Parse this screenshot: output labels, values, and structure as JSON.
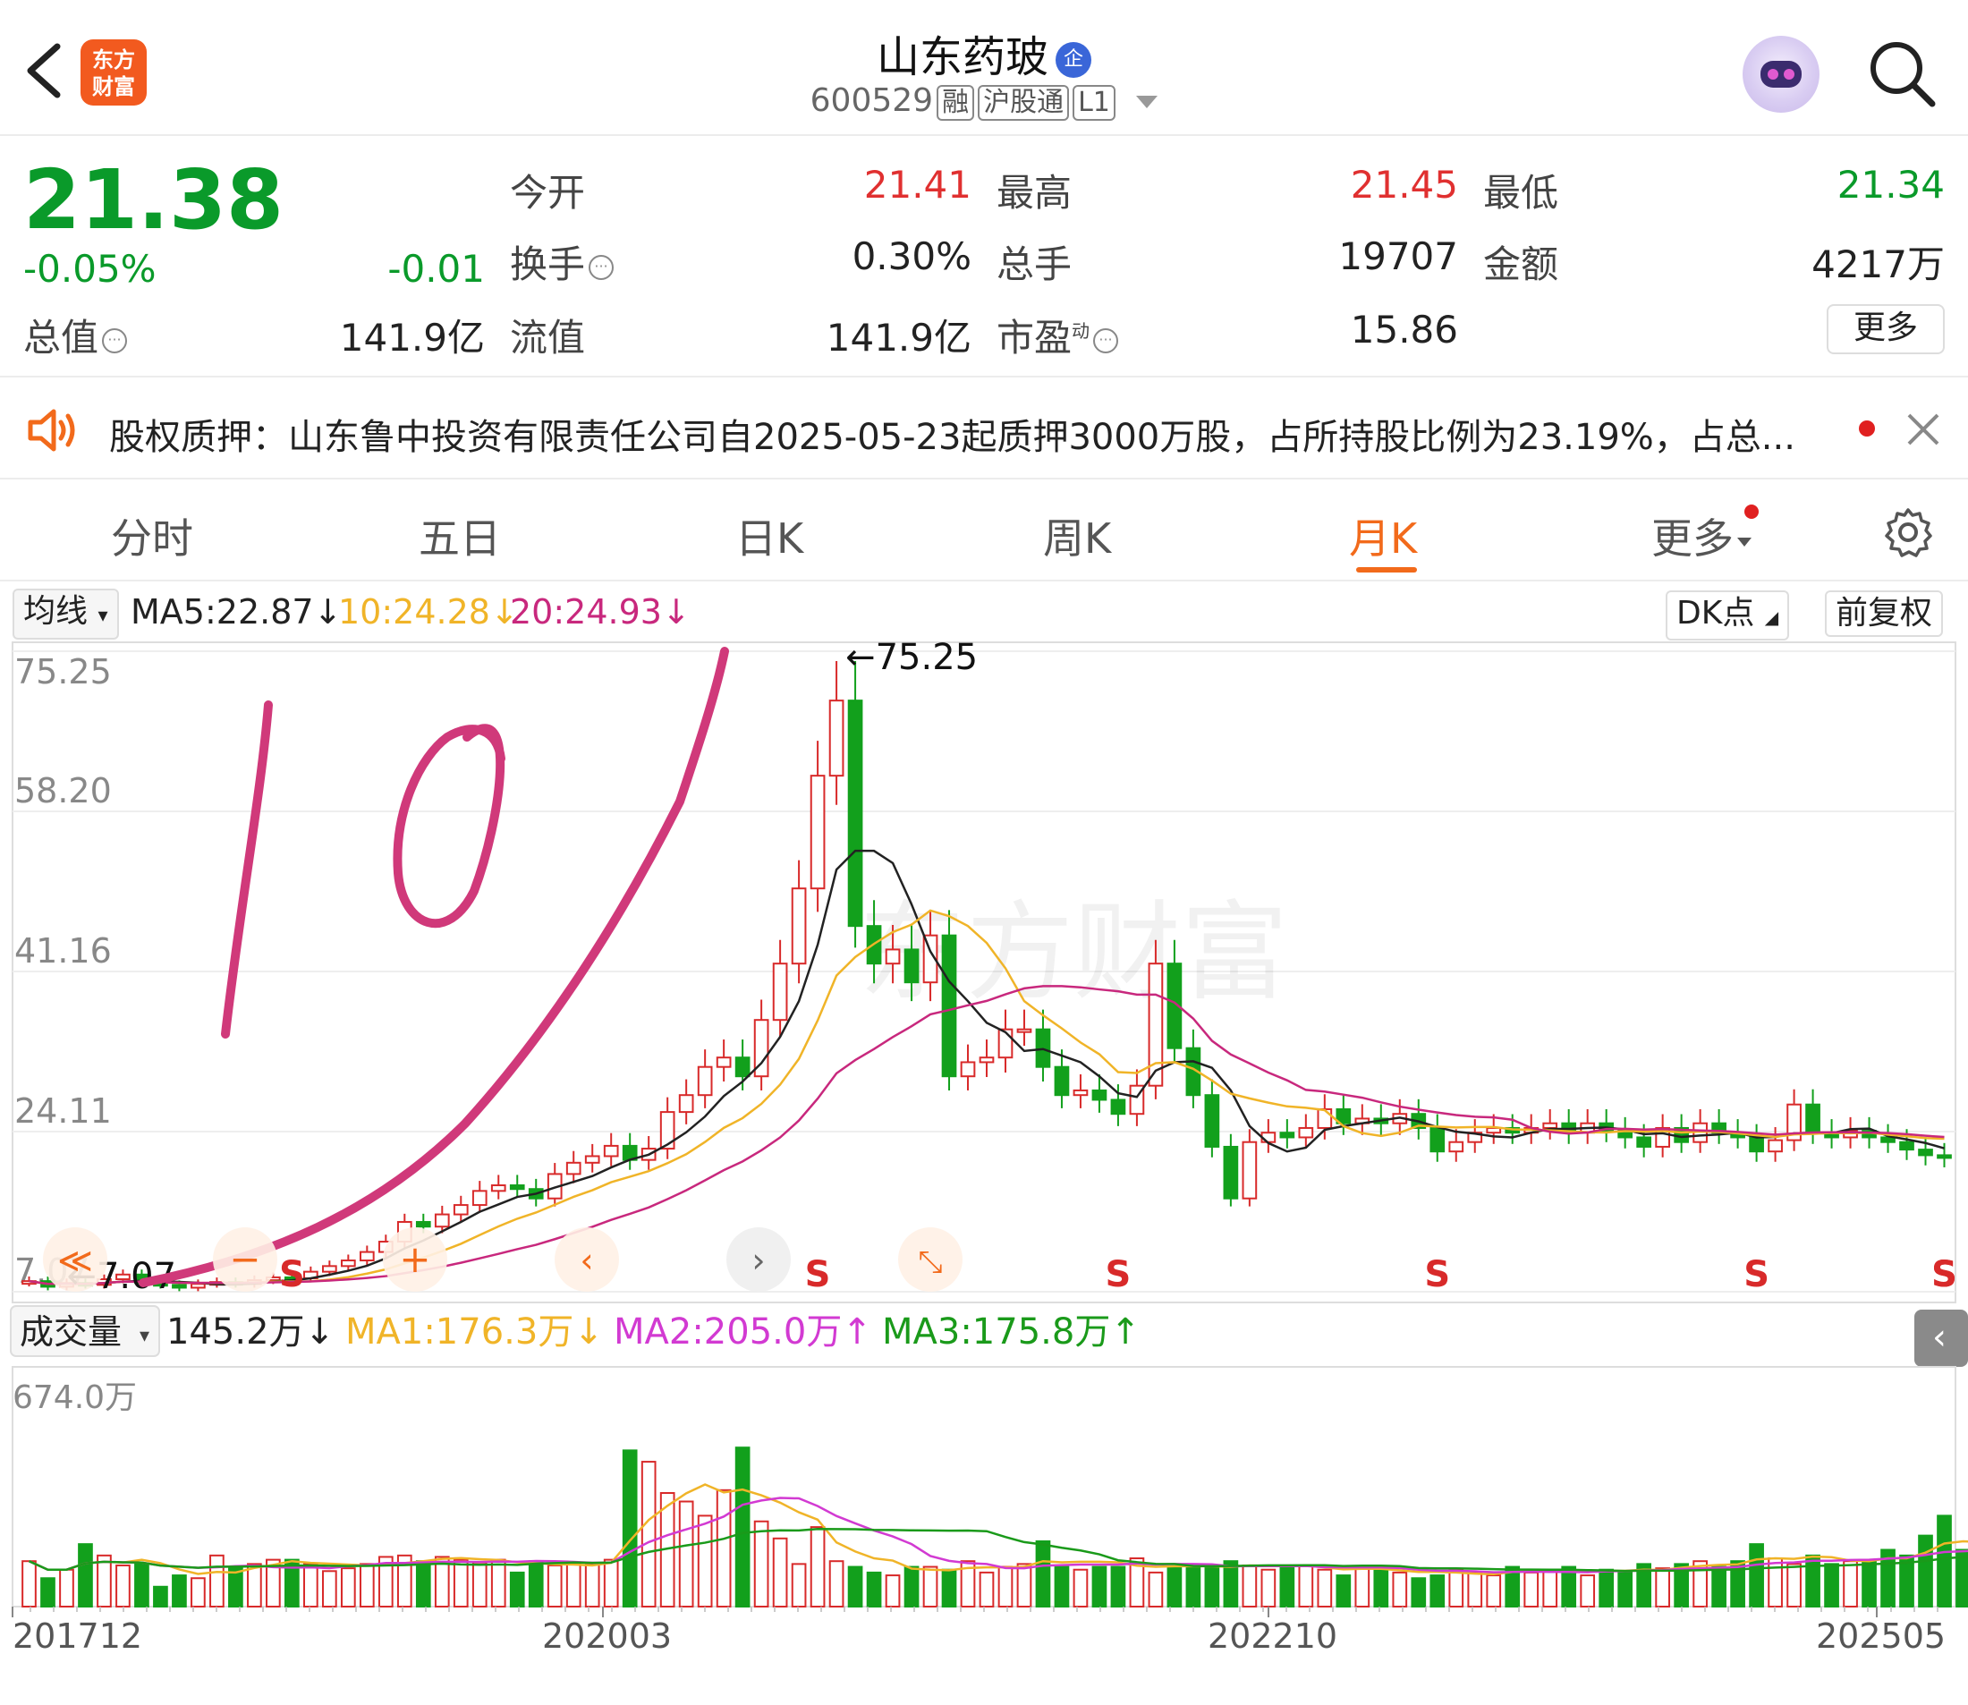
{
  "header": {
    "back_icon": "back-arrow-icon",
    "logo_line1": "东方",
    "logo_line2": "财富",
    "title": "山东药玻",
    "corp_badge": "企",
    "code": "600529",
    "tags": [
      "融",
      "沪股通",
      "L1"
    ]
  },
  "quote": {
    "price": "21.38",
    "change_pct": "-0.05%",
    "change": "-0.01",
    "cells": [
      {
        "label": "今开",
        "value": "21.41",
        "color": "red"
      },
      {
        "label": "最高",
        "value": "21.45",
        "color": "red"
      },
      {
        "label": "最低",
        "value": "21.34",
        "color": "green"
      },
      {
        "label": "换手",
        "value": "0.30%",
        "color": "dark",
        "info": true
      },
      {
        "label": "总手",
        "value": "19707",
        "color": "dark"
      },
      {
        "label": "金额",
        "value": "4217万",
        "color": "dark"
      },
      {
        "label": "流值",
        "value": "141.9亿",
        "color": "dark"
      },
      {
        "label": "市盈",
        "sup": "动",
        "value": "15.86",
        "color": "dark",
        "info": true
      }
    ],
    "total_label": "总值",
    "total_value": "141.9亿",
    "more": "更多"
  },
  "notice": {
    "text": "股权质押：山东鲁中投资有限责任公司自2025-05-23起质押3000万股，占所持股比例为23.19%，占总..."
  },
  "tabs": [
    "分时",
    "五日",
    "日K",
    "周K",
    "月K",
    "更多"
  ],
  "active_tab": "月K",
  "ma": {
    "selector": "均线",
    "ma5": "MA5:22.87↓",
    "ma10": "10:24.28↓",
    "ma20": "20:24.93↓",
    "dk": "DK点",
    "fq": "前复权",
    "colors": {
      "ma5": "#222222",
      "ma10": "#f0b428",
      "ma20": "#c8287d"
    }
  },
  "volume": {
    "selector": "成交量",
    "val": "145.2万↓",
    "ma1": "MA1:176.3万↓",
    "ma2": "MA2:205.0万↑",
    "ma3": "MA3:175.8万↑",
    "colors": {
      "ma1": "#f0b428",
      "ma2": "#d23ad2",
      "ma3": "#1a9a1a"
    }
  },
  "chart_data": {
    "type": "candlestick",
    "y_ticks": [
      "75.25",
      "58.20",
      "41.16",
      "24.11",
      "7.07"
    ],
    "ylim": [
      7.07,
      75.25
    ],
    "high_label": "←75.25",
    "low_label": "←7.07",
    "vol_tick": "674.0万",
    "vol_max": 674,
    "x_ticks": [
      "201712",
      "202003",
      "202210",
      "202505"
    ],
    "signals": [
      "S",
      "S",
      "S",
      "S",
      "S",
      "S",
      "S"
    ],
    "colors": {
      "up": "#d82a2a",
      "down": "#12a01c",
      "grid": "#eeeeee"
    },
    "closes": [
      8.2,
      7.6,
      8.0,
      7.8,
      8.4,
      8.9,
      8.0,
      7.8,
      7.5,
      7.9,
      8.1,
      7.9,
      8.3,
      8.6,
      8.5,
      9.2,
      9.8,
      10.4,
      11.3,
      12.4,
      14.5,
      14.0,
      15.3,
      16.3,
      17.8,
      18.4,
      18.0,
      17.0,
      19.6,
      20.8,
      21.5,
      22.6,
      21.1,
      22.3,
      26.2,
      28.0,
      31.0,
      32.0,
      30.0,
      36.0,
      42.0,
      50.0,
      62.0,
      70.0,
      46.0,
      42.0,
      43.5,
      40.0,
      45.0,
      30.0,
      31.5,
      32.0,
      35.0,
      35.0,
      31.0,
      28.0,
      28.5,
      27.5,
      26.0,
      29.0,
      42.0,
      33.0,
      28.0,
      22.5,
      17.0,
      23.0,
      24.0,
      23.5,
      24.5,
      26.5,
      25.0,
      25.5,
      25.0,
      26.0,
      24.5,
      22.0,
      23.0,
      24.0,
      24.5,
      24.0,
      24.5,
      25.0,
      24.0,
      25.0,
      24.2,
      23.5,
      22.5,
      24.5,
      23.0,
      25.0,
      24.0,
      23.5,
      22.0,
      23.2,
      27.0,
      24.0,
      23.5,
      24.2,
      23.5,
      23.0,
      22.2,
      21.6,
      21.38
    ],
    "volumes": [
      160,
      100,
      130,
      220,
      180,
      145,
      150,
      70,
      110,
      100,
      180,
      140,
      150,
      165,
      165,
      150,
      125,
      135,
      150,
      175,
      180,
      160,
      175,
      165,
      155,
      165,
      120,
      160,
      145,
      150,
      150,
      165,
      550,
      510,
      400,
      370,
      320,
      410,
      560,
      300,
      240,
      150,
      280,
      160,
      140,
      120,
      110,
      140,
      140,
      130,
      160,
      120,
      140,
      150,
      230,
      140,
      130,
      140,
      140,
      170,
      120,
      140,
      140,
      140,
      160,
      145,
      130,
      140,
      145,
      130,
      110,
      140,
      140,
      120,
      100,
      110,
      130,
      120,
      110,
      140,
      120,
      130,
      140,
      110,
      130,
      120,
      150,
      135,
      150,
      160,
      140,
      160,
      220,
      170,
      150,
      180,
      150,
      160,
      160,
      200,
      180,
      250,
      320,
      200,
      180,
      160,
      145
    ]
  }
}
